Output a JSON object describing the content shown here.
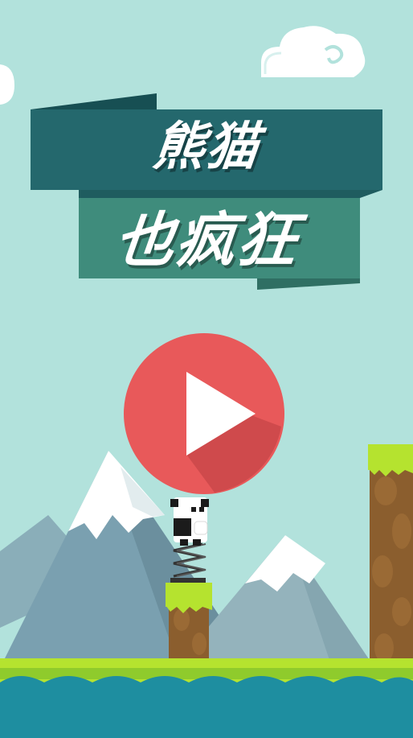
{
  "title": {
    "line1": "熊猫",
    "line2": "也疯狂"
  },
  "colors": {
    "sky": "#b2e2dc",
    "banner_dark": "#24686d",
    "banner_light": "#3f8c7c",
    "play_red": "#e8595a",
    "mountain": "#7aa0b0",
    "snow": "#ffffff",
    "grass": "#b5e32f",
    "dirt": "#8b5e2e",
    "water": "#1e8ea0"
  },
  "icons": {
    "play": "play-triangle-icon",
    "player": "panda-character",
    "spring": "spring-icon"
  }
}
